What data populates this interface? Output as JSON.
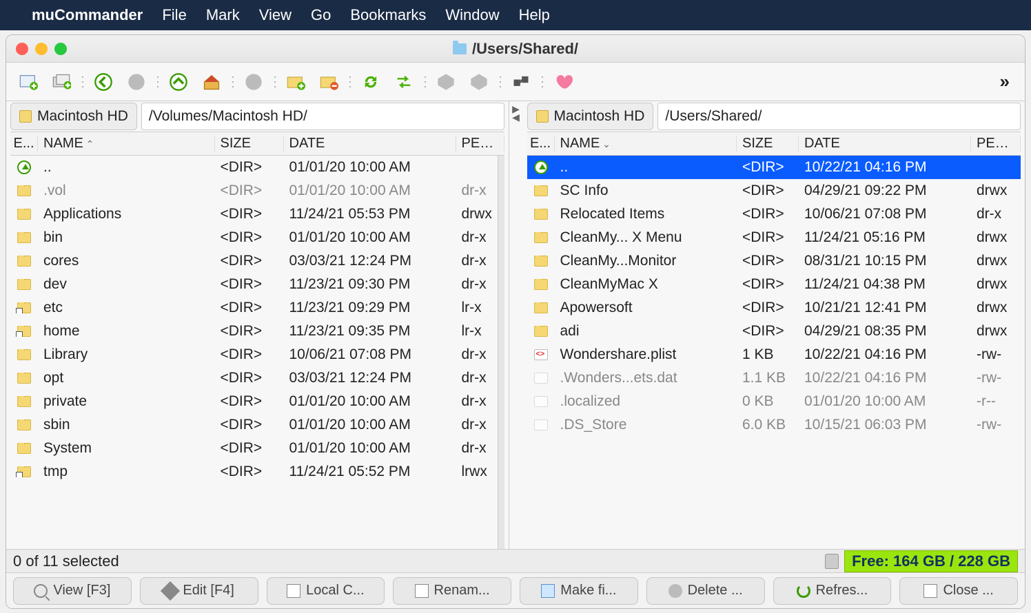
{
  "menubar": {
    "app_name": "muCommander",
    "items": [
      "File",
      "Mark",
      "View",
      "Go",
      "Bookmarks",
      "Window",
      "Help"
    ]
  },
  "window_title": "/Users/Shared/",
  "toolbar": {
    "buttons": [
      "new-window",
      "new-tab",
      "back",
      "forward",
      "parent",
      "home",
      "stop",
      "new-folder",
      "delete",
      "refresh",
      "swap",
      "server1",
      "server2",
      "connect",
      "favorite"
    ]
  },
  "left": {
    "drive": "Macintosh HD",
    "path": "/Volumes/Macintosh HD/",
    "columns": {
      "ext": "E...",
      "name": "NAME",
      "size": "SIZE",
      "date": "DATE",
      "perm": "PER..."
    },
    "rows": [
      {
        "icon": "up",
        "name": "..",
        "size": "<DIR>",
        "date": "01/01/20 10:00 AM",
        "perm": "",
        "dim": false
      },
      {
        "icon": "folder",
        "name": ".vol",
        "size": "<DIR>",
        "date": "01/01/20 10:00 AM",
        "perm": "dr-x",
        "dim": true
      },
      {
        "icon": "folder",
        "name": "Applications",
        "size": "<DIR>",
        "date": "11/24/21 05:53 PM",
        "perm": "drwx",
        "dim": false
      },
      {
        "icon": "folder",
        "name": "bin",
        "size": "<DIR>",
        "date": "01/01/20 10:00 AM",
        "perm": "dr-x",
        "dim": false
      },
      {
        "icon": "folder",
        "name": "cores",
        "size": "<DIR>",
        "date": "03/03/21 12:24 PM",
        "perm": "dr-x",
        "dim": false
      },
      {
        "icon": "folder",
        "name": "dev",
        "size": "<DIR>",
        "date": "11/23/21 09:30 PM",
        "perm": "dr-x",
        "dim": false
      },
      {
        "icon": "folder-link",
        "name": "etc",
        "size": "<DIR>",
        "date": "11/23/21 09:29 PM",
        "perm": "lr-x",
        "dim": false
      },
      {
        "icon": "folder-link",
        "name": "home",
        "size": "<DIR>",
        "date": "11/23/21 09:35 PM",
        "perm": "lr-x",
        "dim": false
      },
      {
        "icon": "folder",
        "name": "Library",
        "size": "<DIR>",
        "date": "10/06/21 07:08 PM",
        "perm": "dr-x",
        "dim": false
      },
      {
        "icon": "folder",
        "name": "opt",
        "size": "<DIR>",
        "date": "03/03/21 12:24 PM",
        "perm": "dr-x",
        "dim": false
      },
      {
        "icon": "folder",
        "name": "private",
        "size": "<DIR>",
        "date": "01/01/20 10:00 AM",
        "perm": "dr-x",
        "dim": false
      },
      {
        "icon": "folder",
        "name": "sbin",
        "size": "<DIR>",
        "date": "01/01/20 10:00 AM",
        "perm": "dr-x",
        "dim": false
      },
      {
        "icon": "folder",
        "name": "System",
        "size": "<DIR>",
        "date": "01/01/20 10:00 AM",
        "perm": "dr-x",
        "dim": false
      },
      {
        "icon": "folder-link",
        "name": "tmp",
        "size": "<DIR>",
        "date": "11/24/21 05:52 PM",
        "perm": "lrwx",
        "dim": false
      }
    ]
  },
  "right": {
    "drive": "Macintosh HD",
    "path": "/Users/Shared/",
    "columns": {
      "ext": "E...",
      "name": "NAME",
      "size": "SIZE",
      "date": "DATE",
      "perm": "PER..."
    },
    "rows": [
      {
        "icon": "up",
        "name": "..",
        "size": "<DIR>",
        "date": "10/22/21 04:16 PM",
        "perm": "",
        "dim": false,
        "selected": true
      },
      {
        "icon": "folder",
        "name": "SC Info",
        "size": "<DIR>",
        "date": "04/29/21 09:22 PM",
        "perm": "drwx",
        "dim": false
      },
      {
        "icon": "folder",
        "name": "Relocated Items",
        "size": "<DIR>",
        "date": "10/06/21 07:08 PM",
        "perm": "dr-x",
        "dim": false
      },
      {
        "icon": "folder",
        "name": "CleanMy... X Menu",
        "size": "<DIR>",
        "date": "11/24/21 05:16 PM",
        "perm": "drwx",
        "dim": false
      },
      {
        "icon": "folder",
        "name": "CleanMy...Monitor",
        "size": "<DIR>",
        "date": "08/31/21 10:15 PM",
        "perm": "drwx",
        "dim": false
      },
      {
        "icon": "folder",
        "name": "CleanMyMac X",
        "size": "<DIR>",
        "date": "11/24/21 04:38 PM",
        "perm": "drwx",
        "dim": false
      },
      {
        "icon": "folder",
        "name": "Apowersoft",
        "size": "<DIR>",
        "date": "10/21/21 12:41 PM",
        "perm": "drwx",
        "dim": false
      },
      {
        "icon": "folder",
        "name": "adi",
        "size": "<DIR>",
        "date": "04/29/21 08:35 PM",
        "perm": "drwx",
        "dim": false
      },
      {
        "icon": "xml",
        "name": "Wondershare.plist",
        "size": "1 KB",
        "date": "10/22/21 04:16 PM",
        "perm": "-rw-",
        "dim": false
      },
      {
        "icon": "file-dim",
        "name": ".Wonders...ets.dat",
        "size": "1.1 KB",
        "date": "10/22/21 04:16 PM",
        "perm": "-rw-",
        "dim": true
      },
      {
        "icon": "file-dim",
        "name": ".localized",
        "size": "0 KB",
        "date": "01/01/20 10:00 AM",
        "perm": "-r--",
        "dim": true
      },
      {
        "icon": "file-dim",
        "name": ".DS_Store",
        "size": "6.0 KB",
        "date": "10/15/21 06:03 PM",
        "perm": "-rw-",
        "dim": true
      }
    ]
  },
  "status": {
    "selected": "0 of 11 selected",
    "free": "Free: 164 GB / 228 GB"
  },
  "commands": {
    "view": "View [F3]",
    "edit": "Edit [F4]",
    "copy": "Local C...",
    "rename": "Renam...",
    "make": "Make fi...",
    "delete": "Delete ...",
    "refresh": "Refres...",
    "close": "Close ..."
  }
}
